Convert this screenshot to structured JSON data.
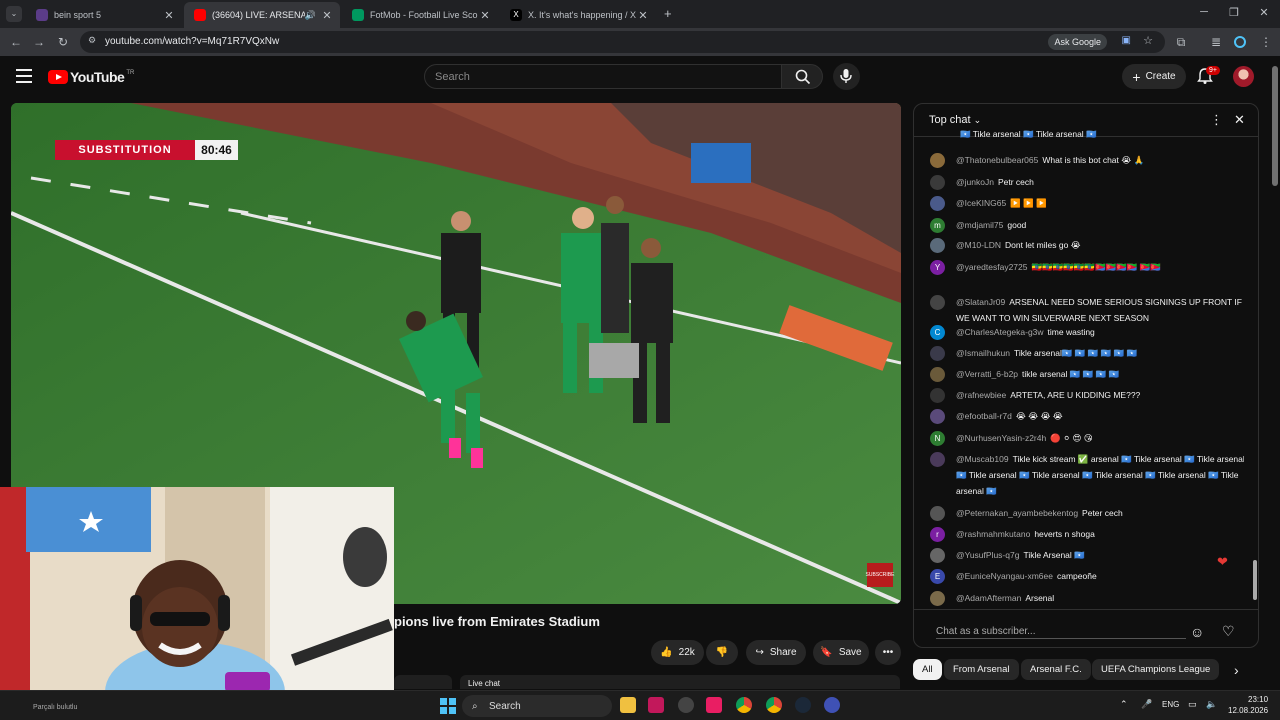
{
  "browser": {
    "tabs": [
      {
        "title": "bein sport 5",
        "favicon_color": "#5b3c88"
      },
      {
        "title": "(36604) LIVE: ARSENAL v C",
        "favicon_color": "#ff0000"
      },
      {
        "title": "FotMob - Football Live Scores",
        "favicon_color": "#00985f"
      },
      {
        "title": "X. It's what's happening / X",
        "favicon_color": "#000000"
      }
    ],
    "url": "youtube.com/watch?v=Mq71R7VQxNw",
    "ask_google": "Ask Google"
  },
  "youtube": {
    "logo_text": "YouTube",
    "logo_region": "TR",
    "search_placeholder": "Search",
    "create_label": "Create",
    "notif_badge": "9+"
  },
  "video": {
    "banner_label": "SUBSTITUTION",
    "banner_time": "80:46",
    "badge_text": "SUBSCRIBE",
    "title_visible": "pions live from Emirates Stadium"
  },
  "actions": {
    "likes": "22k",
    "share": "Share",
    "save": "Save"
  },
  "live_chat_strip": "Live chat",
  "chat": {
    "header": "Top chat",
    "input_placeholder": "Chat as a subscriber...",
    "messages": [
      {
        "author": "",
        "text": "🇸🇴 Tikle arsenal 🇸🇴 Tikle arsenal 🇸🇴",
        "avatar_color": "#555555",
        "avatar_letter": ""
      },
      {
        "author": "@Thatonebulbear065",
        "text": "What is this bot chat 😭 🙏",
        "avatar_color": "#8a6a3a",
        "avatar_letter": ""
      },
      {
        "author": "@junkoJn",
        "text": "Petr cech",
        "avatar_color": "#3a3a3a",
        "avatar_letter": ""
      },
      {
        "author": "@IceKING65",
        "text": "▶️ ▶️ ▶️",
        "avatar_color": "#4a5a8a",
        "avatar_letter": ""
      },
      {
        "author": "@mdjamil75",
        "text": "good",
        "avatar_color": "#2e7d32",
        "avatar_letter": "m"
      },
      {
        "author": "@M10-LDN",
        "text": "Dont let miles go 😭",
        "avatar_color": "#5a6a7a",
        "avatar_letter": ""
      },
      {
        "author": "@yaredtesfay2725",
        "text": "🇪🇹🇪🇹🇪🇹🇪🇹🇪🇹🇪🇹🇪🇷🇪🇷🇪🇷🇪🇷 🇪🇷🇪🇷",
        "avatar_color": "#7b1fa2",
        "avatar_letter": "Y"
      },
      {
        "author": "@SlatanJr09",
        "text": "ARSENAL NEED SOME SERIOUS SIGNINGS UP FRONT IF WE WANT TO WIN SILVERWARE NEXT SEASON",
        "avatar_color": "#444444",
        "avatar_letter": ""
      },
      {
        "author": "@CharlesAtegeka-g3w",
        "text": "time wasting",
        "avatar_color": "#0288d1",
        "avatar_letter": "C"
      },
      {
        "author": "@Ismailhukun",
        "text": "Tikle arsenal🇸🇴 🇸🇴 🇸🇴 🇸🇴 🇸🇴 🇸🇴",
        "avatar_color": "#3a3a4a",
        "avatar_letter": ""
      },
      {
        "author": "@Verratti_6-b2p",
        "text": "tikle arsenal 🇸🇴 🇸🇴 🇸🇴 🇸🇴",
        "avatar_color": "#6a5a3a",
        "avatar_letter": ""
      },
      {
        "author": "@rafnewbiee",
        "text": "ARTETA, ARE U KIDDING ME???",
        "avatar_color": "#333333",
        "avatar_letter": ""
      },
      {
        "author": "@efootball-r7d",
        "text": "😭 😭 😭 😭",
        "avatar_color": "#5a4a7a",
        "avatar_letter": ""
      },
      {
        "author": "@NurhusenYasin-z2r4h",
        "text": "🔴 ⚪ 😍 😘",
        "avatar_color": "#2e7d32",
        "avatar_letter": "N"
      },
      {
        "author": "@Muscab109",
        "text": "Tikle kick stream ✅ arsenal 🇸🇴 Tikle arsenal 🇸🇴 Tikle arsenal 🇸🇴 Tikle arsenal 🇸🇴 Tikle arsenal 🇸🇴 Tikle arsenal 🇸🇴 Tikle arsenal 🇸🇴 Tikle arsenal 🇸🇴",
        "avatar_color": "#4a3a5a",
        "avatar_letter": ""
      },
      {
        "author": "@Peternakan_ayambebekentog",
        "text": "Peter cech",
        "avatar_color": "#555555",
        "avatar_letter": ""
      },
      {
        "author": "@rashmahmkutano",
        "text": "heverts n shoga",
        "avatar_color": "#7b1fa2",
        "avatar_letter": "r"
      },
      {
        "author": "@YusufPlus-q7g",
        "text": "Tikle Arsenal 🇸🇴",
        "avatar_color": "#666666",
        "avatar_letter": ""
      },
      {
        "author": "@EuniceNyangau-xm6ee",
        "text": "campeoñe",
        "avatar_color": "#3949ab",
        "avatar_letter": "E"
      },
      {
        "author": "@AdamAfterman",
        "text": "Arsenal",
        "avatar_color": "#7a6a4a",
        "avatar_letter": ""
      }
    ]
  },
  "chips": [
    "All",
    "From Arsenal",
    "Arsenal F.C.",
    "UEFA Champions League"
  ],
  "taskbar": {
    "search": "Search",
    "lang": "ENG",
    "time": "23:10",
    "date": "12.08.2026",
    "left_text": "Parçalı bulutlu"
  },
  "colors": {
    "yt_red": "#ff0000",
    "background": "#0f0f0f",
    "sub_banner_red": "#c8102e"
  }
}
